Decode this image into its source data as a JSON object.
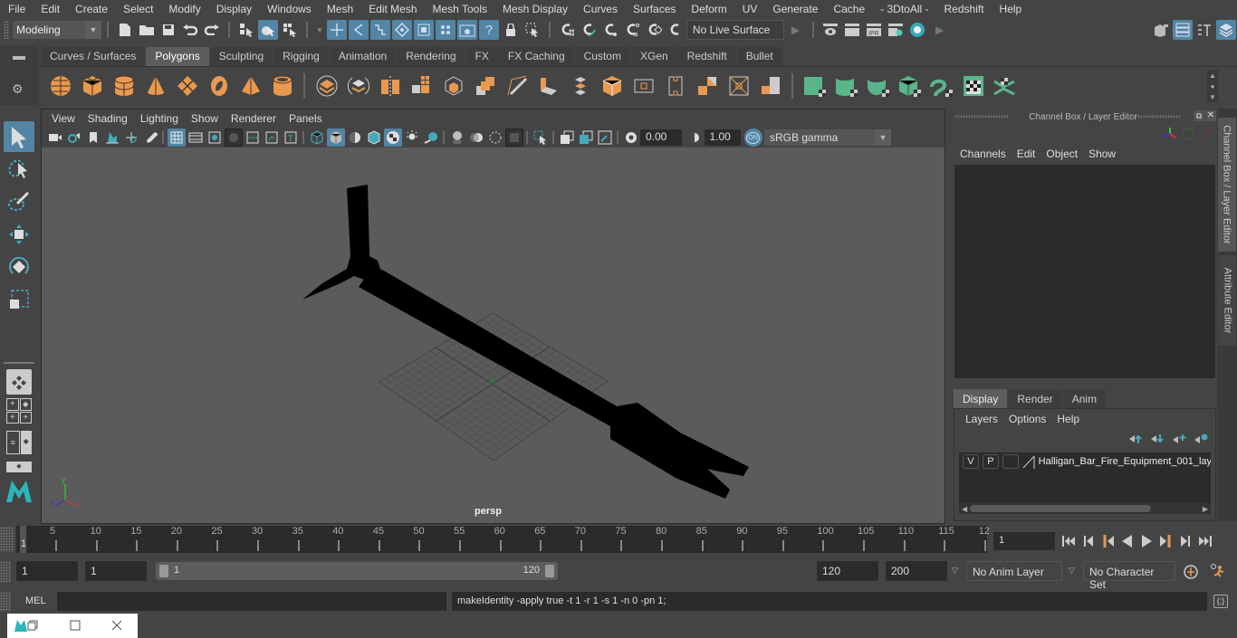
{
  "menubar": {
    "items": [
      "File",
      "Edit",
      "Create",
      "Select",
      "Modify",
      "Display",
      "Windows",
      "Mesh",
      "Edit Mesh",
      "Mesh Tools",
      "Mesh Display",
      "Curves",
      "Surfaces",
      "Deform",
      "UV",
      "Generate",
      "Cache",
      "- 3DtoAll -",
      "Redshift",
      "Help"
    ]
  },
  "statusline": {
    "workspace": "Modeling",
    "live_surface": "No Live Surface"
  },
  "shelf": {
    "tabs": [
      "Curves / Surfaces",
      "Polygons",
      "Sculpting",
      "Rigging",
      "Animation",
      "Rendering",
      "FX",
      "FX Caching",
      "Custom",
      "XGen",
      "Redshift",
      "Bullet"
    ],
    "active_tab": "Polygons",
    "icons": [
      "poly-sphere",
      "poly-cube",
      "poly-cylinder",
      "poly-cone",
      "poly-plane",
      "poly-torus",
      "poly-pyramid",
      "poly-pipe",
      "combine",
      "separate",
      "mirror",
      "smooth",
      "extract",
      "booleans",
      "multi-cut",
      "bridge",
      "extrude",
      "bevel",
      "append",
      "edge-loop",
      "insert-loop",
      "offset-loop",
      "bevel-edge",
      "target-weld",
      "fill-hole",
      "planar-uv",
      "cylindrical-uv",
      "spherical-uv",
      "automatic-uv",
      "unfold-uv",
      "uv-editor",
      "uv-sew"
    ]
  },
  "panel": {
    "menus": [
      "View",
      "Shading",
      "Lighting",
      "Show",
      "Renderer",
      "Panels"
    ],
    "exposure": "0.00",
    "gamma": "1.00",
    "color_space": "sRGB gamma",
    "camera_label": "persp"
  },
  "channel_box": {
    "title": "Channel Box / Layer Editor",
    "menus": [
      "Channels",
      "Edit",
      "Object",
      "Show"
    ],
    "layer_tabs": [
      "Display",
      "Render",
      "Anim"
    ],
    "active_layer_tab": "Display",
    "layer_menus": [
      "Layers",
      "Options",
      "Help"
    ],
    "layers": [
      {
        "v": "V",
        "p": "P",
        "name": "Halligan_Bar_Fire_Equipment_001_lay"
      }
    ]
  },
  "side_tabs": [
    "Channel Box / Layer Editor",
    "Attribute Editor"
  ],
  "timeline": {
    "ticks": [
      "5",
      "10",
      "15",
      "20",
      "25",
      "30",
      "35",
      "40",
      "45",
      "50",
      "55",
      "60",
      "65",
      "70",
      "75",
      "80",
      "85",
      "90",
      "95",
      "100",
      "105",
      "110",
      "115",
      "12"
    ],
    "current_frame_marker": "1",
    "current_frame": "1"
  },
  "range": {
    "start": "1",
    "playback_start": "1",
    "slider_start": "1",
    "slider_end": "120",
    "playback_end": "120",
    "end": "200",
    "anim_layer": "No Anim Layer",
    "character_set": "No Character Set"
  },
  "cmdline": {
    "label": "MEL",
    "input": "",
    "feedback": "makeIdentity -apply true -t 1 -r 1 -s 1 -n 0 -pn 1;"
  },
  "colors": {
    "accent": "#5285a6",
    "shelf_orange": "#e8994f",
    "shelf_green": "#5ab58a",
    "viewport_bg": "#5b5b5b"
  }
}
